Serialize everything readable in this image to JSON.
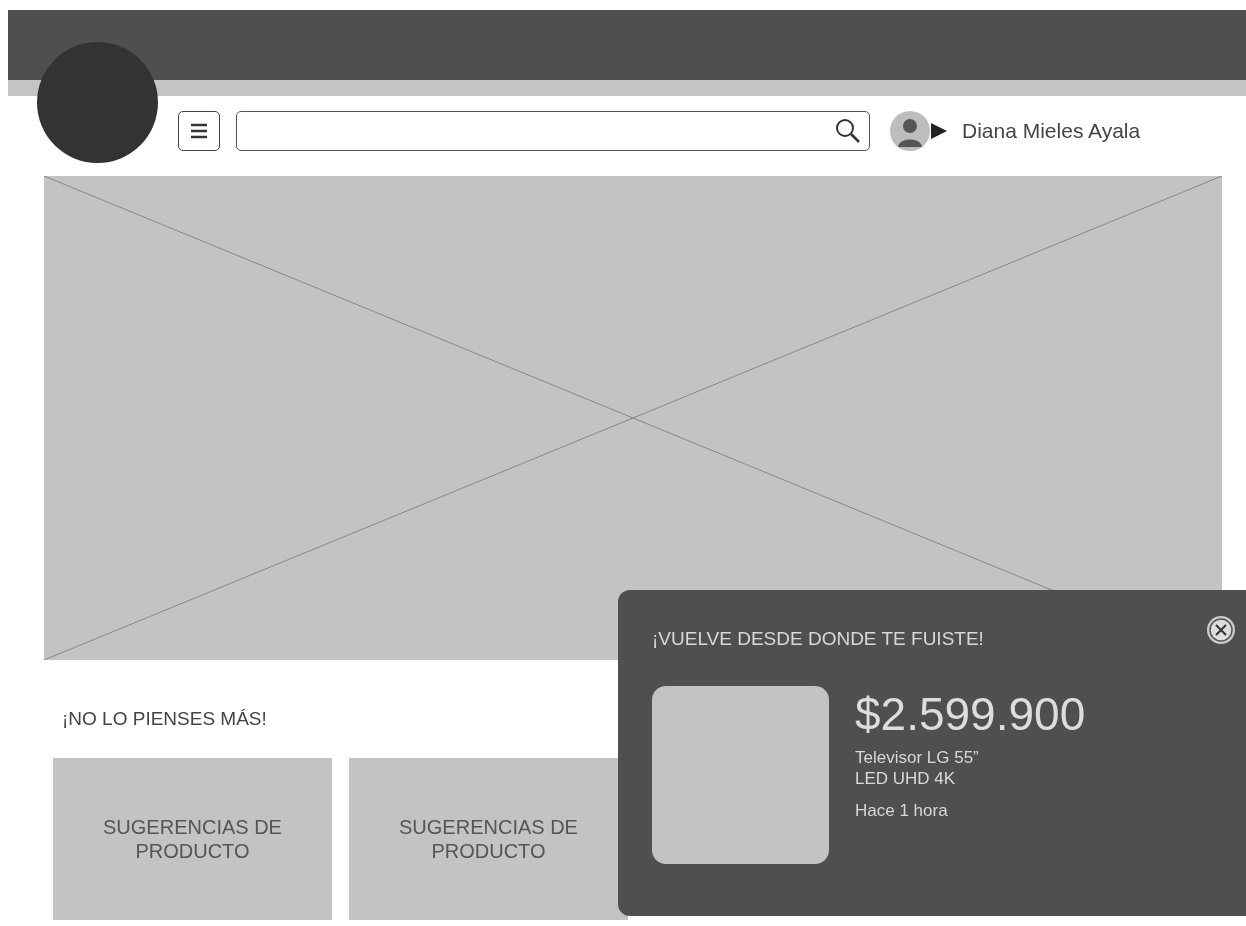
{
  "header": {
    "user": {
      "name": "Diana Mieles Ayala"
    }
  },
  "hero": {
    "kind": "placeholder"
  },
  "section": {
    "title": "¡NO LO PIENSES MÁS!",
    "cards": [
      {
        "label": "SUGERENCIAS DE PRODUCTO"
      },
      {
        "label": "SUGERENCIAS DE PRODUCTO"
      }
    ]
  },
  "popup": {
    "title": "¡VUELVE DESDE DONDE TE FUISTE!",
    "price": "$2.599.900",
    "description": "Televisor LG 55”\nLED UHD 4K",
    "time": "Hace 1 hora"
  }
}
